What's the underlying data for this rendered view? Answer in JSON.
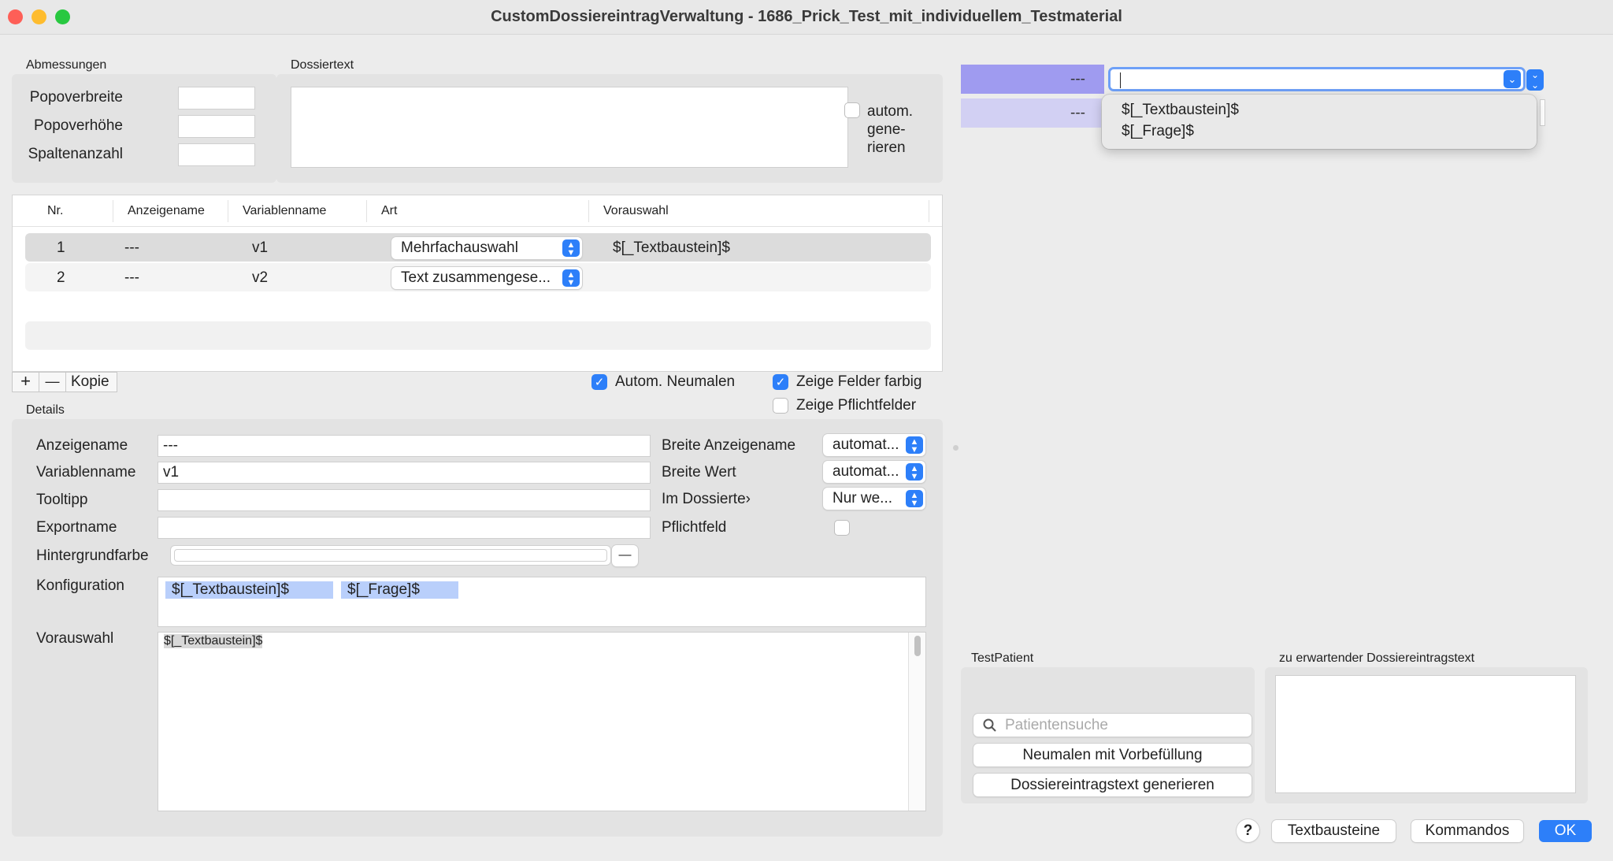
{
  "window": {
    "title": "CustomDossiereintragVerwaltung - 1686_Prick_Test_mit_individuellem_Testmaterial"
  },
  "dimensions": {
    "label": "Abmessungen",
    "popover_width_label": "Popoverbreite",
    "popover_height_label": "Popoverhöhe",
    "column_count_label": "Spaltenanzahl",
    "popover_width_value": "",
    "popover_height_value": "",
    "column_count_value": ""
  },
  "dossiertext": {
    "label": "Dossiertext",
    "value": "",
    "auto_generate_label": "autom. gene- rieren",
    "auto_generate_checked": false
  },
  "table": {
    "columns": [
      "Nr.",
      "Anzeigename",
      "Variablenname",
      "Art",
      "Vorauswahl"
    ],
    "rows": [
      {
        "nr": "1",
        "anzeigename": "---",
        "variablenname": "v1",
        "art": "Mehrfachauswahl",
        "vorauswahl": "$[_Textbaustein]$",
        "selected": true
      },
      {
        "nr": "2",
        "anzeigename": "---",
        "variablenname": "v2",
        "art": "Text zusammengese...",
        "vorauswahl": "",
        "selected": false
      }
    ]
  },
  "table_toolbar": {
    "add_label": "+",
    "remove_label": "—",
    "copy_label": "Kopie",
    "auto_repaint_label": "Autom. Neumalen",
    "auto_repaint_checked": true,
    "show_colored_label": "Zeige Felder farbig",
    "show_colored_checked": true,
    "show_required_label": "Zeige Pflichtfelder",
    "show_required_checked": false
  },
  "details": {
    "label": "Details",
    "anzeigename_label": "Anzeigename",
    "anzeigename_value": "---",
    "variablenname_label": "Variablenname",
    "variablenname_value": "v1",
    "tooltipp_label": "Tooltipp",
    "tooltipp_value": "",
    "exportname_label": "Exportname",
    "exportname_value": "",
    "hintergrundfarbe_label": "Hintergrundfarbe",
    "hintergrundfarbe_button": "—",
    "breite_anzeigename_label": "Breite Anzeigename",
    "breite_anzeigename_value": "automat...",
    "breite_wert_label": "Breite Wert",
    "breite_wert_value": "automat...",
    "im_dossiertext_label": "Im Dossierte›",
    "im_dossiertext_value": "Nur we...",
    "pflichtfeld_label": "Pflichtfeld",
    "pflichtfeld_checked": false,
    "konfiguration_label": "Konfiguration",
    "konfiguration_tags": [
      "$[_Textbaustein]$",
      "$[_Frage]$"
    ],
    "vorauswahl_label": "Vorauswahl",
    "vorauswahl_value": "$[_Textbaustein]$"
  },
  "preview": {
    "row1_label": "---",
    "row1_value": "",
    "row2_label": "---",
    "dropdown_options": [
      "$[_Textbaustein]$",
      "$[_Frage]$"
    ]
  },
  "testpatient": {
    "label": "TestPatient",
    "search_placeholder": "Patientensuche",
    "repaint_button": "Neumalen mit Vorbefüllung",
    "generate_button": "Dossiereintragstext generieren"
  },
  "expected": {
    "label": "zu erwartender Dossiereintragstext",
    "value": ""
  },
  "footer": {
    "help_label": "?",
    "textbausteine_label": "Textbausteine",
    "kommandos_label": "Kommandos",
    "ok_label": "OK"
  },
  "colors": {
    "accent": "#2d7ff9",
    "preview_row1": "#9f9bf0",
    "preview_row2": "#d2d0f3",
    "tag_bg": "#b9cffb",
    "close": "#fe5f57",
    "minimize": "#febc2e",
    "zoom": "#28c840"
  }
}
